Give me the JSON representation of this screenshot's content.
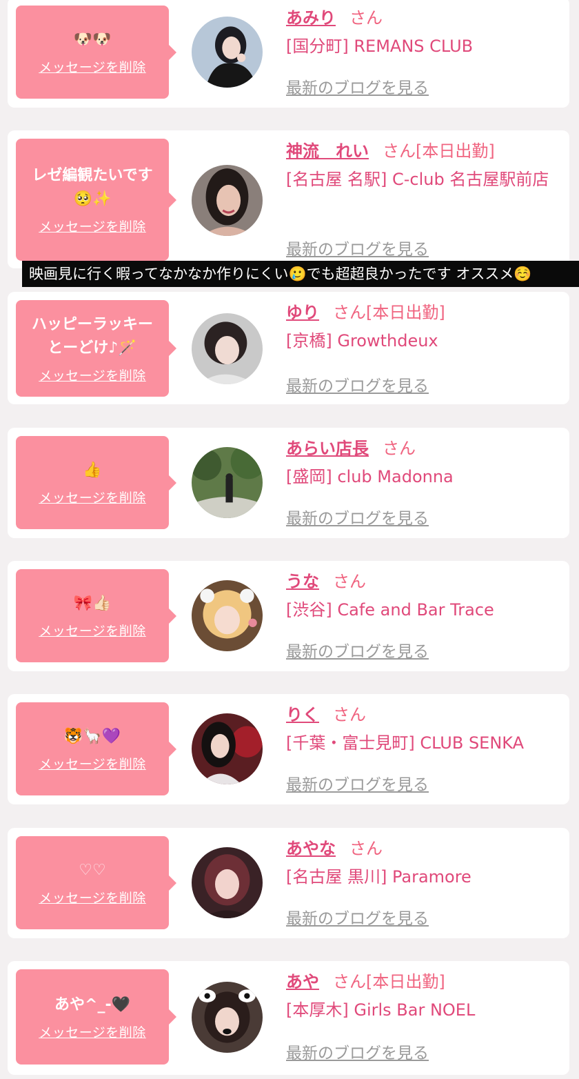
{
  "cards": [
    {
      "message": "🐶🐶",
      "delete_label": "メッセージを削除",
      "name": "あみり",
      "honorific": "さん",
      "status": "",
      "shop": "[国分町] REMANS CLUB",
      "blog_label": "最新のブログを見る"
    },
    {
      "message": "レゼ編観たいです\n🥺✨",
      "delete_label": "メッセージを削除",
      "name": "神流　れい",
      "honorific": "さん",
      "status": "[本日出勤]",
      "shop": "[名古屋 名駅] C-club 名古屋駅前店",
      "blog_label": "最新のブログを見る"
    },
    {
      "message": "ハッピーラッキー\nとーどけ♪🪄",
      "delete_label": "メッセージを削除",
      "name": "ゆり",
      "honorific": "さん",
      "status": "[本日出勤]",
      "shop": "[京橋] Growthdeux",
      "blog_label": "最新のブログを見る"
    },
    {
      "message": "👍",
      "delete_label": "メッセージを削除",
      "name": "あらい店長",
      "honorific": "さん",
      "status": "",
      "shop": "[盛岡] club Madonna",
      "blog_label": "最新のブログを見る"
    },
    {
      "message": "🎀👍🏻",
      "delete_label": "メッセージを削除",
      "name": "うな",
      "honorific": "さん",
      "status": "",
      "shop": "[渋谷] Cafe and Bar Trace",
      "blog_label": "最新のブログを見る"
    },
    {
      "message": "🐯🦙💜",
      "delete_label": "メッセージを削除",
      "name": "りく",
      "honorific": "さん",
      "status": "",
      "shop": "[千葉・富士見町] CLUB SENKA",
      "blog_label": "最新のブログを見る"
    },
    {
      "message": "♡♡",
      "delete_label": "メッセージを削除",
      "name": "あやな",
      "honorific": "さん",
      "status": "",
      "shop": "[名古屋 黒川] Paramore",
      "blog_label": "最新のブログを見る"
    },
    {
      "message": "あや^_-🖤",
      "delete_label": "メッセージを削除",
      "name": "あや",
      "honorific": "さん",
      "status": "[本日出勤]",
      "shop": "[本厚木] Girls Bar NOEL",
      "blog_label": "最新のブログを見る"
    }
  ],
  "caption_text": "映画見に行く暇ってなかなか作りにくい🥲でも超超良かったです オススメ☺️",
  "colors": {
    "bubble": "#fb909f",
    "name": "#e0497a",
    "link_gray": "#9a9a9a",
    "background": "#f3f0f1"
  }
}
